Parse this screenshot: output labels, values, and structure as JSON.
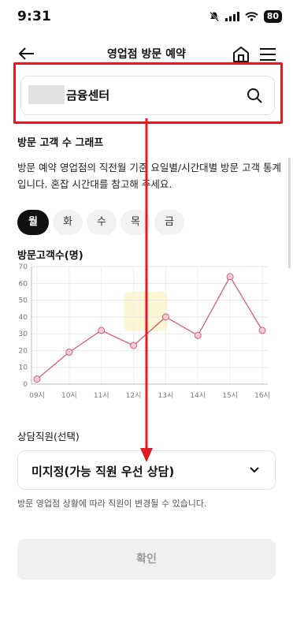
{
  "status_bar": {
    "time": "9:31",
    "battery": "80"
  },
  "header": {
    "title": "영업점 방문 예약"
  },
  "search": {
    "text": "금융센터"
  },
  "visit_graph": {
    "title": "방문 고객 수 그래프",
    "description": "방문 예약 영업점의 직전월 기준 요일별/시간대별 방문 고객 통계입니다. 혼잡 시간대를 참고해 주세요.",
    "days": [
      "월",
      "화",
      "수",
      "목",
      "금"
    ],
    "active_day": "월"
  },
  "chart_data": {
    "type": "line",
    "title": "방문고객수(명)",
    "x": [
      "09시",
      "10시",
      "11시",
      "12시",
      "13시",
      "14시",
      "15시",
      "16시"
    ],
    "y_ticks": [
      0,
      10,
      20,
      30,
      40,
      50,
      60,
      70
    ],
    "ylim": [
      0,
      70
    ],
    "series": [
      {
        "values": [
          3,
          19,
          32,
          23,
          40,
          29,
          64,
          32
        ]
      }
    ],
    "grid": true,
    "color": "#d1607a"
  },
  "counselor": {
    "label": "상담직원(선택)",
    "value": "미지정(가능 직원 우선 상담)",
    "helper": "방문 영업점 상황에 따라 직원이 변경될 수 있습니다."
  },
  "confirm": {
    "label": "확인"
  },
  "colors": {
    "highlight": "#e11b22",
    "accent": "#d1607a"
  }
}
